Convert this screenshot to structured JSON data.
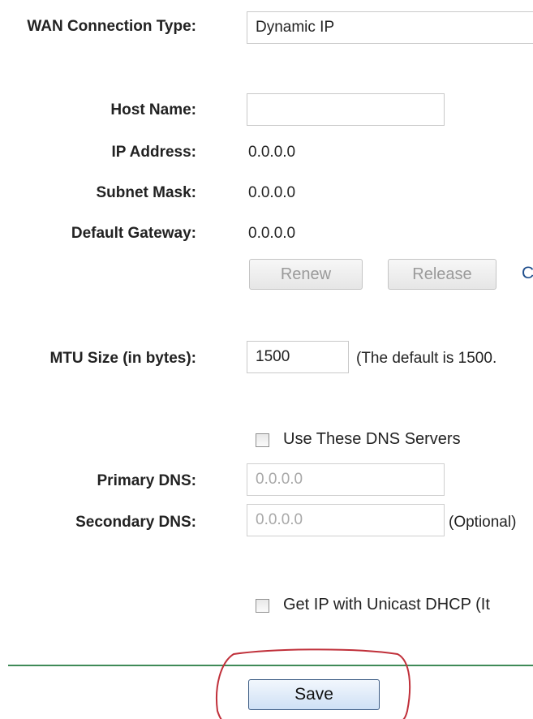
{
  "wan": {
    "label": "WAN Connection Type:",
    "value": "Dynamic IP"
  },
  "host_name": {
    "label": "Host Name:",
    "value": ""
  },
  "ip_address": {
    "label": "IP Address:",
    "value": "0.0.0.0"
  },
  "subnet_mask": {
    "label": "Subnet Mask:",
    "value": "0.0.0.0"
  },
  "default_gateway": {
    "label": "Default Gateway:",
    "value": "0.0.0.0"
  },
  "buttons": {
    "renew": "Renew",
    "release": "Release",
    "cut_off": "C"
  },
  "mtu": {
    "label": "MTU Size (in bytes):",
    "value": "1500",
    "hint": "(The default is 1500."
  },
  "dns": {
    "use_servers_label": "Use These DNS Servers",
    "primary_label": "Primary DNS:",
    "primary_value": "0.0.0.0",
    "secondary_label": "Secondary DNS:",
    "secondary_value": "0.0.0.0",
    "secondary_hint": "(Optional)"
  },
  "unicast": {
    "label": "Get IP with Unicast DHCP (It"
  },
  "save": {
    "label": "Save"
  },
  "colors": {
    "divider": "#3f8a57",
    "annotation_circle": "#c0303a",
    "link": "#1f4e8c"
  }
}
